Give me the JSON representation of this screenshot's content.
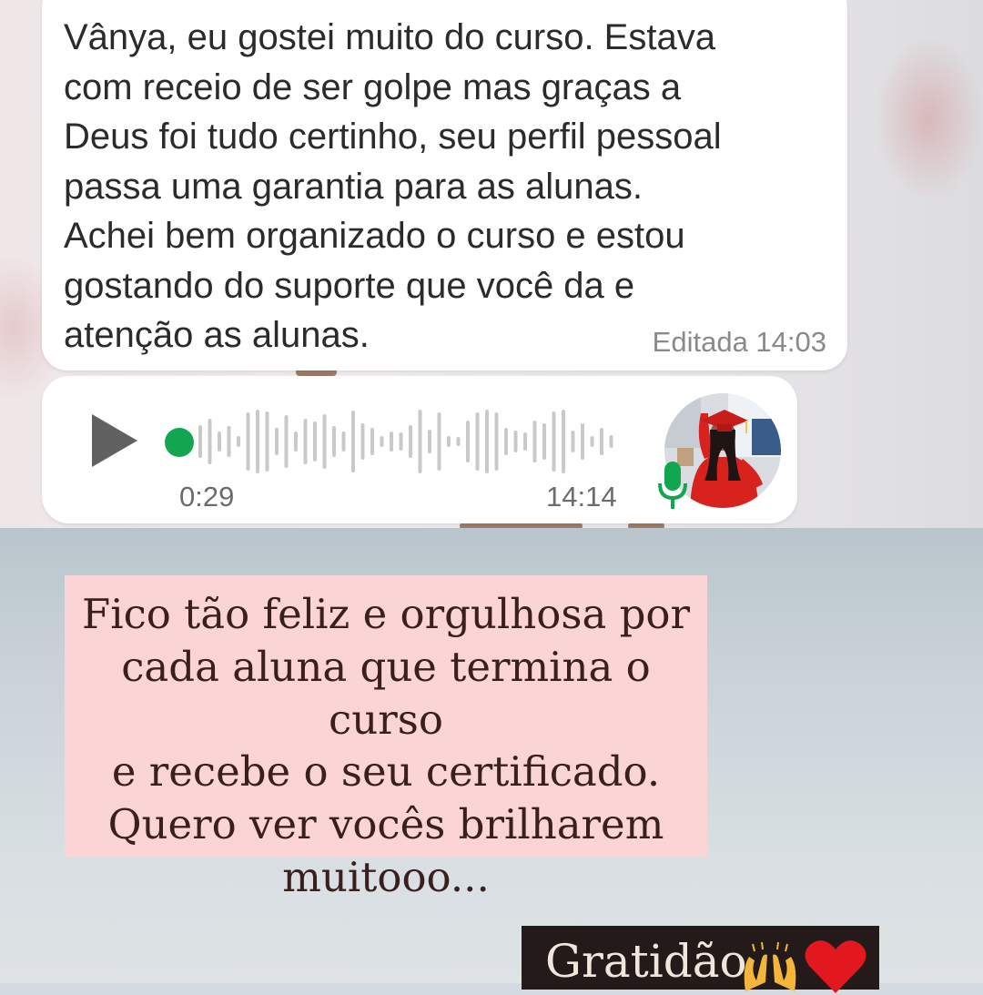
{
  "chat": {
    "message": {
      "text": "Vânya, eu gostei muito do curso. Estava\ncom receio de ser golpe mas graças a\nDeus foi tudo certinho, seu perfil pessoal\npassa uma garantia para as alunas.\nAchei  bem organizado o curso e estou\ngostando do suporte que você da e\natenção as alunas.",
      "meta": "Editada 14:03"
    },
    "voice_note": {
      "duration": "0:29",
      "time": "14:14",
      "progress": 0,
      "play_icon": "play-icon",
      "mic_icon": "microphone-icon",
      "accent_color": "#12a650"
    }
  },
  "caption": {
    "text": "Fico tão feliz e orgulhosa por\ncada aluna que termina o curso\ne recebe o seu certificado.\nQuero ver vocês brilharem\nmuitooo...",
    "background": "#fbd5d5"
  },
  "tag": {
    "text": "Gratidão",
    "icons": [
      "raising-hands-icon",
      "heart-icon"
    ]
  }
}
